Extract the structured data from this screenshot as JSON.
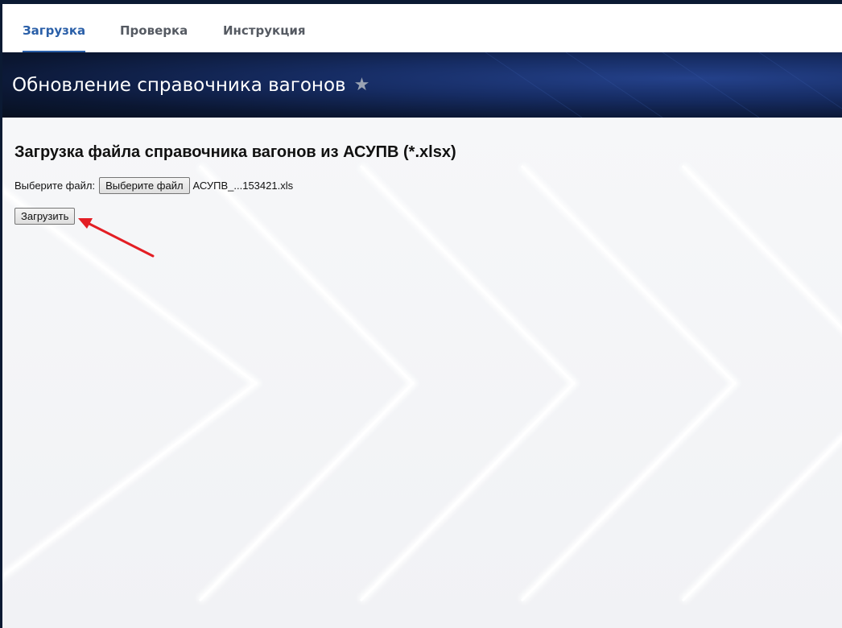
{
  "tabs": [
    {
      "label": "Загрузка",
      "active": true
    },
    {
      "label": "Проверка",
      "active": false
    },
    {
      "label": "Инструкция",
      "active": false
    }
  ],
  "hero": {
    "title": "Обновление справочника вагонов",
    "icon": "star-icon"
  },
  "upload_form": {
    "heading": "Загрузка файла справочника вагонов из АСУПВ (*.xlsx)",
    "file_label": "Выберите файл:",
    "file_button_label": "Выберите файл",
    "file_name": "АСУПВ_...153421.xls",
    "submit_label": "Загрузить"
  },
  "annotation": {
    "icon": "red-arrow-icon",
    "color": "#e31e24"
  },
  "colors": {
    "accent": "#2a5fa8",
    "hero_dark": "#0b1733",
    "annotation_red": "#e31e24"
  }
}
